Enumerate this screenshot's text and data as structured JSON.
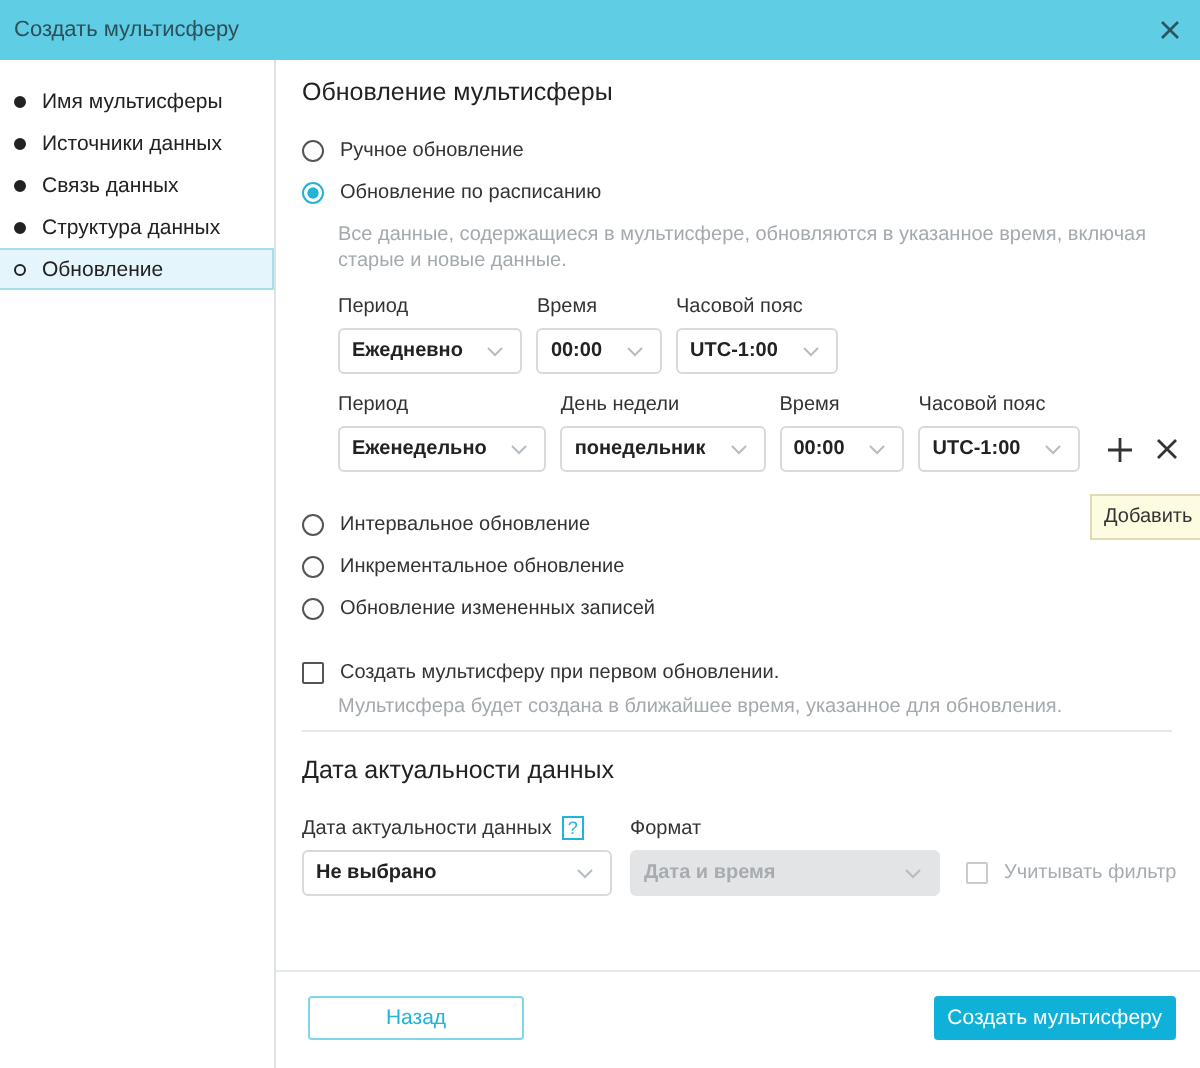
{
  "window": {
    "title": "Создать мультисферу"
  },
  "sidebar": {
    "items": [
      {
        "label": "Имя мультисферы",
        "done": true,
        "selected": false
      },
      {
        "label": "Источники данных",
        "done": true,
        "selected": false
      },
      {
        "label": "Связь данных",
        "done": true,
        "selected": false
      },
      {
        "label": "Структура данных",
        "done": true,
        "selected": false
      },
      {
        "label": "Обновление",
        "done": false,
        "selected": true
      }
    ]
  },
  "update_section": {
    "title": "Обновление мультисферы",
    "options": [
      {
        "label": "Ручное обновление",
        "selected": false
      },
      {
        "label": "Обновление по расписанию",
        "selected": true,
        "description": "Все данные, содержащиеся в мультисфере, обновляются в указанное время, включая старые и новые данные.",
        "schedules": [
          {
            "has_actions": false,
            "fields": [
              {
                "label": "Период",
                "value": "Ежедневно"
              },
              {
                "label": "Время",
                "value": "00:00"
              },
              {
                "label": "Часовой пояс",
                "value": "UTC-1:00"
              }
            ]
          },
          {
            "has_actions": true,
            "tooltip": "Добавить",
            "fields": [
              {
                "label": "Период",
                "value": "Еженедельно"
              },
              {
                "label": "День недели",
                "value": "понедельник"
              },
              {
                "label": "Время",
                "value": "00:00"
              },
              {
                "label": "Часовой пояс",
                "value": "UTC-1:00"
              }
            ]
          }
        ]
      },
      {
        "label": "Интервальное обновление",
        "selected": false
      },
      {
        "label": "Инкрементальное обновление",
        "selected": false
      },
      {
        "label": "Обновление измененных записей",
        "selected": false
      }
    ],
    "create_on_first_update": {
      "label": "Создать мультисферу при первом обновлении.",
      "checked": false,
      "hint": "Мультисфера будет создана в ближайшее время, указанное для обновления."
    }
  },
  "date_section": {
    "title": "Дата актуальности данных",
    "date_field": {
      "label": "Дата актуальности данных",
      "help": "?",
      "value": "Не выбрано",
      "disabled": false
    },
    "format_field": {
      "label": "Формат",
      "value": "Дата и время",
      "disabled": true
    },
    "filter_checkbox": {
      "label": "Учитывать фильтр",
      "checked": false,
      "disabled": true
    }
  },
  "footer": {
    "back": "Назад",
    "submit": "Создать мультисферу"
  }
}
